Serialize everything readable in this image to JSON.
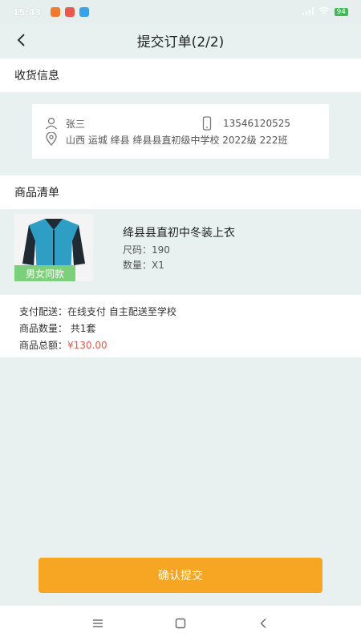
{
  "status_bar": {
    "time": "15:43",
    "battery": "94"
  },
  "header": {
    "title": "提交订单(2/2)"
  },
  "shipping": {
    "section_title": "收货信息",
    "name": "张三",
    "phone": "13546120525",
    "address": "山西 运城 绛县 绛县县直初级中学校 2022级 222班"
  },
  "goods_list": {
    "section_title": "商品清单",
    "items": [
      {
        "name": "绛县县直初中冬装上衣",
        "size": "尺码：190",
        "quantity": "数量：X1",
        "tag": "男女同款"
      }
    ]
  },
  "summary": {
    "payment_delivery": "支付配送：在线支付 自主配送至学校",
    "item_count": "商品数量： 共1套",
    "total_label": "商品总额：",
    "total_value": "¥130.00"
  },
  "actions": {
    "confirm_label": "确认提交"
  },
  "colors": {
    "accent": "#f6a623",
    "price": "#e35a4a",
    "tag": "#7cd07c",
    "background": "#e8f0f0"
  }
}
